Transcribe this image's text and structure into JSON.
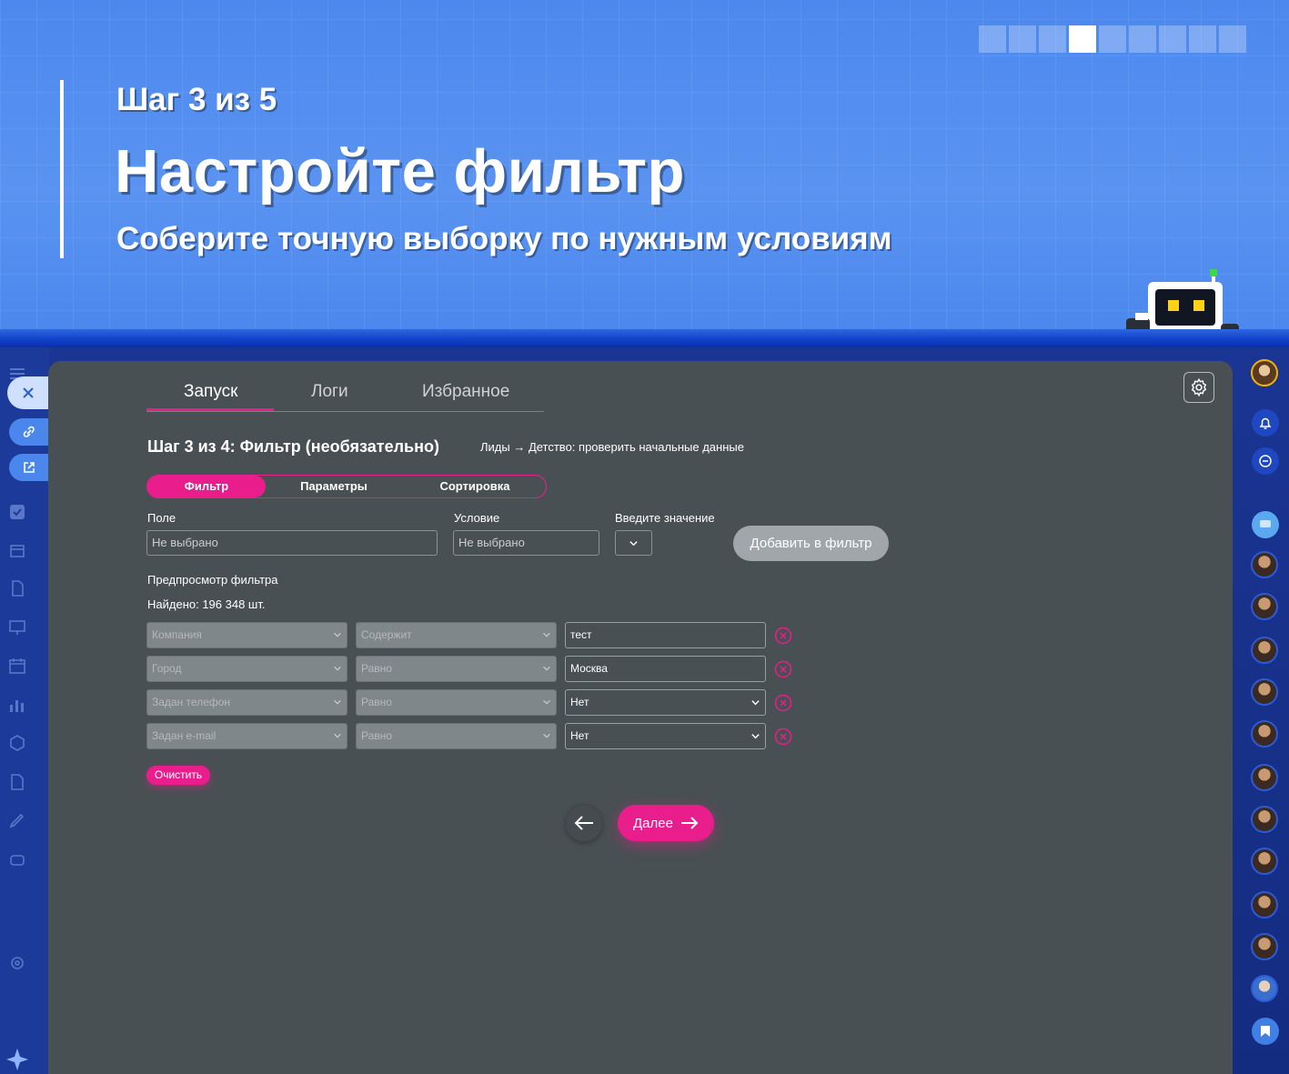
{
  "banner": {
    "step": "Шаг 3 из 5",
    "title": "Настройте фильтр",
    "subtitle": "Соберите точную выборку по нужным условиям",
    "progress": {
      "total": 9,
      "active_index": 3
    }
  },
  "tabs": [
    {
      "label": "Запуск",
      "active": true
    },
    {
      "label": "Логи",
      "active": false
    },
    {
      "label": "Избранное",
      "active": false
    }
  ],
  "step": {
    "title": "Шаг 3 из 4: Фильтр (необязательно)",
    "breadcrumb": "Лиды → Детство: проверить начальные данные"
  },
  "segments": [
    {
      "label": "Фильтр",
      "active": true
    },
    {
      "label": "Параметры",
      "active": false
    },
    {
      "label": "Сортировка",
      "active": false
    }
  ],
  "form": {
    "field_label": "Поле",
    "field_placeholder": "Не выбрано",
    "condition_label": "Условие",
    "condition_placeholder": "Не выбрано",
    "value_label": "Введите значение",
    "add_button": "Добавить в фильтр"
  },
  "preview": {
    "label": "Предпросмотр фильтра",
    "found": "Найдено: 196 348 шт."
  },
  "filters": [
    {
      "field": "Компания",
      "condition": "Содержит",
      "value": "тест",
      "value_is_select": false
    },
    {
      "field": "Город",
      "condition": "Равно",
      "value": "Москва",
      "value_is_select": false
    },
    {
      "field": "Задан телефон",
      "condition": "Равно",
      "value": "Нет",
      "value_is_select": true
    },
    {
      "field": "Задан e-mail",
      "condition": "Равно",
      "value": "Нет",
      "value_is_select": true
    }
  ],
  "actions": {
    "clear": "Очистить",
    "next": "Далее"
  },
  "colors": {
    "accent": "#e91e8c",
    "modal_bg": "#495053",
    "banner_bg": "#4a86ec"
  },
  "icons": {
    "gear": "gear-icon",
    "back": "arrow-left-icon",
    "next": "arrow-right-icon",
    "remove": "close-circle-icon",
    "chevron": "chevron-down-icon"
  }
}
